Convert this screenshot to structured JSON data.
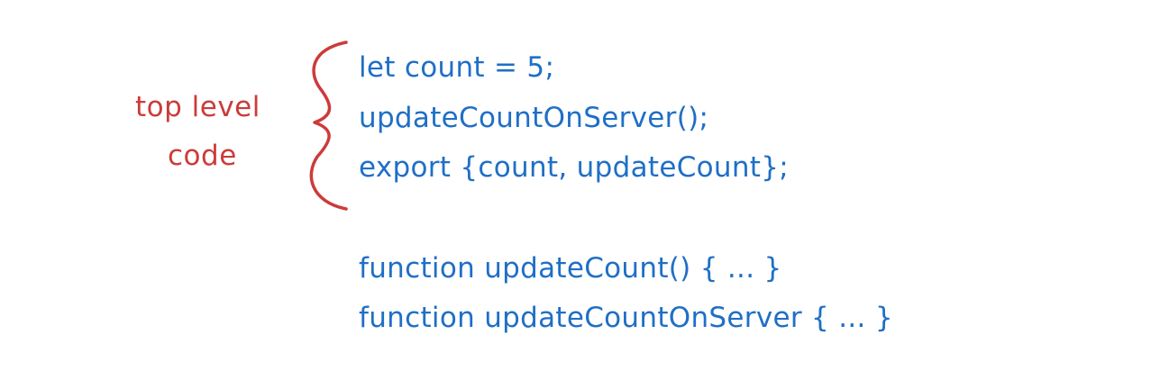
{
  "annotation": {
    "line1": "top level",
    "line2": "code"
  },
  "top_level_code": [
    "let count = 5;",
    "updateCountOnServer();",
    "export {count, updateCount};"
  ],
  "functions": [
    "function updateCount() { ... }",
    "function updateCountOnServer { ... }"
  ],
  "colors": {
    "annotation": "#cc3b3b",
    "code": "#1f6fc6",
    "brace": "#cc3b3b"
  }
}
